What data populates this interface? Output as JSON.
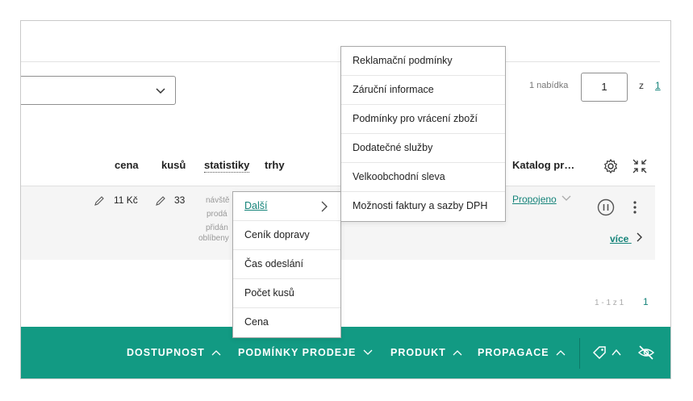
{
  "toolbar": {
    "offers_label": "1 nabídka",
    "page_value": "1",
    "page_of": "z",
    "page_total": "1"
  },
  "table": {
    "headers": {
      "cena": "cena",
      "kusu": "kusů",
      "statistiky": "statistiky",
      "trhy": "trhy",
      "katalog": "Katalog pr…"
    },
    "row": {
      "price": "11 Kč",
      "qty": "33",
      "stats": [
        "návště",
        "prodá",
        "přidán",
        "oblíbeny"
      ],
      "catalog_status": "Propojeno",
      "more": "více"
    }
  },
  "submenu_left": {
    "items": [
      "Další",
      "Ceník dopravy",
      "Čas odeslání",
      "Počet kusů",
      "Cena"
    ]
  },
  "submenu_right": {
    "items": [
      "Reklamační podmínky",
      "Záruční informace",
      "Podmínky pro vrácení zboží",
      "Dodatečné služby",
      "Velkoobchodní sleva",
      "Možnosti faktury a sazby DPH"
    ]
  },
  "pagination_bottom": {
    "label": "1 - 1 z 1",
    "page": "1"
  },
  "bottom_bar": {
    "items": [
      "DOSTUPNOST",
      "PODMÍNKY PRODEJE",
      "PRODUKT",
      "PROPAGACE"
    ],
    "color": "#129a83"
  },
  "icons": [
    "chevron-down-icon",
    "gear-icon",
    "collapse-icon",
    "pencil-icon",
    "pause-icon",
    "kebab-icon",
    "chevron-right-icon",
    "tag-icon",
    "eye-off-icon"
  ],
  "accent": "#16847a"
}
